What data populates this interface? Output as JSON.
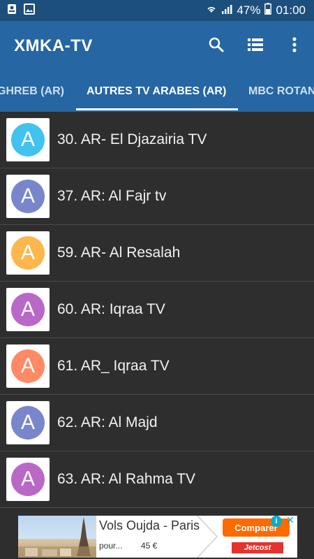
{
  "status_bar": {
    "battery": "47%",
    "time": "01:00",
    "icons": [
      "notification-icon",
      "image-icon",
      "wifi-icon",
      "signal-icon",
      "battery-icon"
    ]
  },
  "toolbar": {
    "title": "XMKA-TV",
    "actions": [
      "search-icon",
      "list-view-icon",
      "more-vert-icon"
    ]
  },
  "tabs": [
    {
      "label": "GHREB  (AR)",
      "active": false
    },
    {
      "label": "AUTRES TV ARABES (AR)",
      "active": true
    },
    {
      "label": "MBC ROTAN",
      "active": false
    }
  ],
  "channels": [
    {
      "avatar_letter": "A",
      "color": "#42c3ef",
      "label": "30. AR- El Djazairia TV"
    },
    {
      "avatar_letter": "A",
      "color": "#7986cb",
      "label": "37. AR: Al Fajr tv"
    },
    {
      "avatar_letter": "A",
      "color": "#ffb74d",
      "label": "59. AR- Al Resalah"
    },
    {
      "avatar_letter": "A",
      "color": "#ba68c8",
      "label": "60. AR: Iqraa TV"
    },
    {
      "avatar_letter": "A",
      "color": "#ff8a65",
      "label": "61. AR_ Iqraa TV"
    },
    {
      "avatar_letter": "A",
      "color": "#7986cb",
      "label": "62. AR: Al Majd"
    },
    {
      "avatar_letter": "A",
      "color": "#ba68c8",
      "label": "63. AR: Al Rahma TV"
    }
  ],
  "ad": {
    "title": "Vols Oujda - Paris",
    "subtitle": "pour...",
    "price": "45 €",
    "button": "Comparer",
    "brand": "Jetcost",
    "info": "i",
    "close": "✕"
  },
  "colors": {
    "status_bar": "#1d4f7c",
    "toolbar": "#2566a3",
    "list_background": "#2e2e2e",
    "ad_button": "#ff6a00"
  }
}
